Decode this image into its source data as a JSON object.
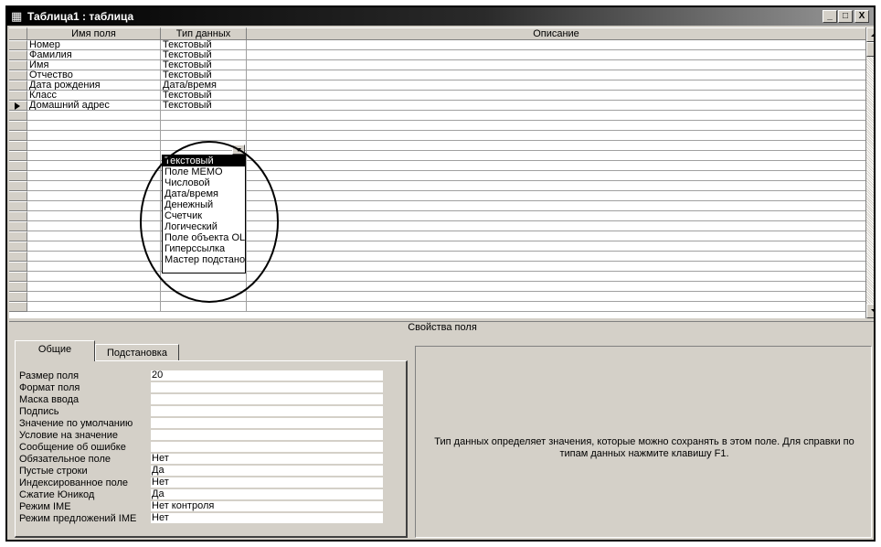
{
  "window": {
    "title": "Таблица1 : таблица",
    "icon": "table-icon",
    "buttons": {
      "minimize": "_",
      "maximize": "□",
      "close": "X"
    }
  },
  "grid": {
    "columns": [
      "Имя поля",
      "Тип данных",
      "Описание"
    ],
    "rows": [
      {
        "name": "Номер",
        "type": "Текстовый"
      },
      {
        "name": "Фамилия",
        "type": "Текстовый"
      },
      {
        "name": "Имя",
        "type": "Текстовый"
      },
      {
        "name": "Отчество",
        "type": "Текстовый"
      },
      {
        "name": "Дата рождения",
        "type": "Дата/время"
      },
      {
        "name": "Класс",
        "type": "Текстовый"
      },
      {
        "name": "Домашний адрес",
        "type": "Текстовый"
      }
    ],
    "current_row": 6
  },
  "dropdown": {
    "options": [
      "Текстовый",
      "Поле MEMO",
      "Числовой",
      "Дата/время",
      "Денежный",
      "Счетчик",
      "Логический",
      "Поле объекта OLE",
      "Гиперссылка",
      "Мастер подстановок..."
    ],
    "selected_index": 0
  },
  "properties": {
    "header": "Свойства поля",
    "tabs": [
      "Общие",
      "Подстановка"
    ],
    "active_tab": 0,
    "rows": [
      {
        "label": "Размер поля",
        "value": "20"
      },
      {
        "label": "Формат поля",
        "value": ""
      },
      {
        "label": "Маска ввода",
        "value": ""
      },
      {
        "label": "Подпись",
        "value": ""
      },
      {
        "label": "Значение по умолчанию",
        "value": ""
      },
      {
        "label": "Условие на значение",
        "value": ""
      },
      {
        "label": "Сообщение об ошибке",
        "value": ""
      },
      {
        "label": "Обязательное поле",
        "value": "Нет"
      },
      {
        "label": "Пустые строки",
        "value": "Да"
      },
      {
        "label": "Индексированное поле",
        "value": "Нет"
      },
      {
        "label": "Сжатие Юникод",
        "value": "Да"
      },
      {
        "label": "Режим IME",
        "value": "Нет контроля"
      },
      {
        "label": "Режим предложений IME",
        "value": "Нет"
      }
    ],
    "help_text": "Тип данных определяет значения, которые можно сохранять в этом поле.  Для справки по типам данных нажмите клавишу F1."
  }
}
